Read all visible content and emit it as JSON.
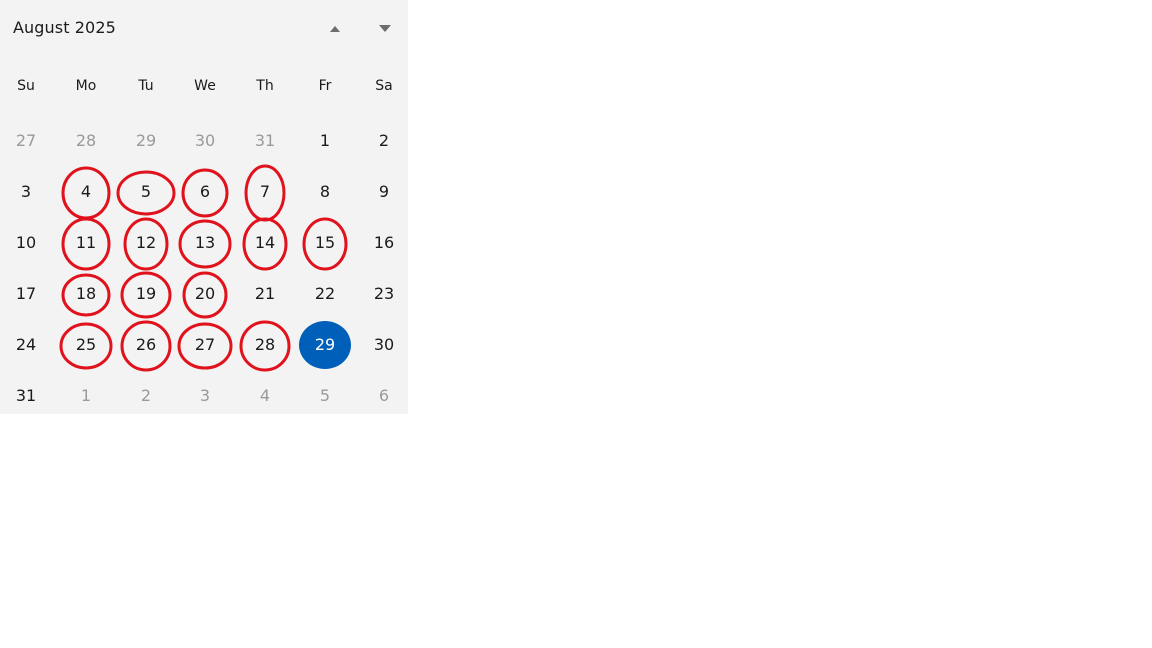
{
  "calendar": {
    "title": "August 2025",
    "nav_prev_icon": "triangle-up-icon",
    "nav_next_icon": "triangle-down-icon",
    "weekdays": [
      "Su",
      "Mo",
      "Tu",
      "We",
      "Th",
      "Fr",
      "Sa"
    ],
    "selected_day": "29",
    "accent_color": "#005fb8",
    "annotation_color": "#e0121c",
    "weeks": [
      [
        {
          "d": "27",
          "o": true
        },
        {
          "d": "28",
          "o": true
        },
        {
          "d": "29",
          "o": true
        },
        {
          "d": "30",
          "o": true
        },
        {
          "d": "31",
          "o": true
        },
        {
          "d": "1"
        },
        {
          "d": "2"
        }
      ],
      [
        {
          "d": "3"
        },
        {
          "d": "4",
          "m": true
        },
        {
          "d": "5",
          "m": true
        },
        {
          "d": "6",
          "m": true
        },
        {
          "d": "7",
          "m": true
        },
        {
          "d": "8"
        },
        {
          "d": "9"
        }
      ],
      [
        {
          "d": "10"
        },
        {
          "d": "11",
          "m": true
        },
        {
          "d": "12",
          "m": true
        },
        {
          "d": "13",
          "m": true
        },
        {
          "d": "14",
          "m": true
        },
        {
          "d": "15",
          "m": true
        },
        {
          "d": "16"
        }
      ],
      [
        {
          "d": "17"
        },
        {
          "d": "18",
          "m": true
        },
        {
          "d": "19",
          "m": true
        },
        {
          "d": "20",
          "m": true
        },
        {
          "d": "21"
        },
        {
          "d": "22"
        },
        {
          "d": "23"
        }
      ],
      [
        {
          "d": "24"
        },
        {
          "d": "25",
          "m": true
        },
        {
          "d": "26",
          "m": true
        },
        {
          "d": "27",
          "m": true
        },
        {
          "d": "28",
          "m": true
        },
        {
          "d": "29",
          "s": true
        },
        {
          "d": "30"
        }
      ],
      [
        {
          "d": "31"
        },
        {
          "d": "1",
          "o": true
        },
        {
          "d": "2",
          "o": true
        },
        {
          "d": "3",
          "o": true
        },
        {
          "d": "4",
          "o": true
        },
        {
          "d": "5",
          "o": true
        },
        {
          "d": "6",
          "o": true
        }
      ]
    ]
  }
}
